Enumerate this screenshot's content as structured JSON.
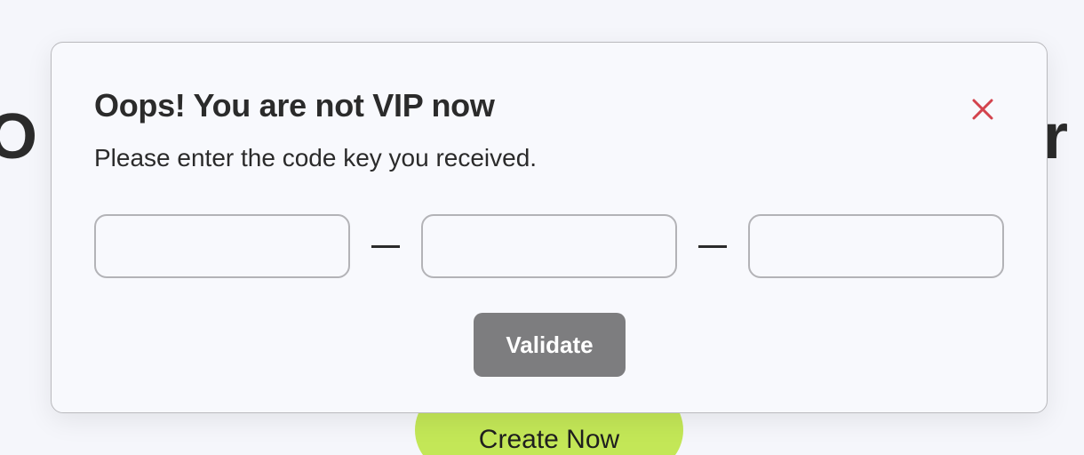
{
  "background": {
    "heading_left_fragment": "O",
    "heading_right_fragment": "r",
    "cta_label": "Create Now",
    "cta_color": "#c3e757"
  },
  "modal": {
    "title": "Oops! You are not VIP now",
    "subtitle": "Please enter the code key you received.",
    "close_icon": "close-icon",
    "close_color": "#d3434d",
    "code_key": {
      "groups": [
        {
          "cells": [
            "",
            "",
            "",
            ""
          ]
        },
        {
          "cells": [
            "",
            "",
            "",
            ""
          ]
        },
        {
          "cells": [
            "",
            "",
            "",
            ""
          ]
        }
      ],
      "separator_icon": "dash-icon"
    },
    "validate_label": "Validate",
    "validate_color": "#7d7d7f"
  }
}
